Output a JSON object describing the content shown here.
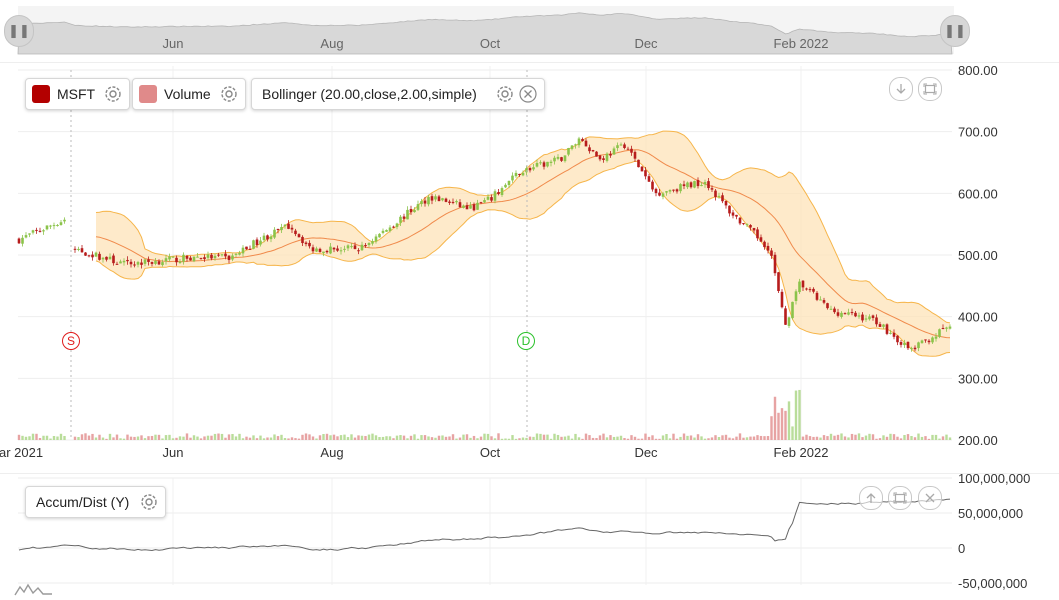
{
  "navigator": {
    "labels": [
      "Jun",
      "Aug",
      "Oct",
      "Dec",
      "Feb 2022"
    ],
    "handle_left_icon": "pause-grip-icon",
    "handle_right_icon": "pause-grip-icon"
  },
  "legend": {
    "series": [
      {
        "name": "MSFT",
        "color": "#b30000",
        "icon": "gear-icon"
      },
      {
        "name": "Volume",
        "color": "#e08a8a",
        "icon": "gear-icon"
      },
      {
        "name": "Bollinger (20.00,close,2.00,simple)",
        "icon": "gear-icon",
        "close_icon": "close-icon"
      }
    ],
    "indicator": {
      "name": "Accum/Dist (Y)",
      "icon": "gear-icon"
    }
  },
  "toolbar": {
    "main": [
      "download-icon",
      "expand-icon"
    ],
    "indicator": [
      "move-up-icon",
      "expand-icon",
      "close-icon"
    ]
  },
  "markers": [
    {
      "label": "S",
      "color": "#e01b1b",
      "date": "Mar 2021"
    },
    {
      "label": "D",
      "color": "#2bc12b",
      "date": "Oct 2021"
    }
  ],
  "colors": {
    "up": "#8bc34a",
    "down": "#b71c1c",
    "band_fill": "#fde3b8",
    "band_line": "#f6b54a",
    "middle_line": "#f08a4b",
    "ad_line": "#666666"
  },
  "chart_data": [
    {
      "type": "candlestick",
      "series": [
        {
          "name": "MSFT"
        },
        {
          "name": "Bollinger (20.00,close,2.00,simple)"
        },
        {
          "name": "Volume"
        }
      ],
      "x_tick_labels": [
        "ar 2021",
        "Jun",
        "Aug",
        "Oct",
        "Dec",
        "Feb 2022"
      ],
      "y_tick_labels": [
        "800.00",
        "700.00",
        "600.00",
        "500.00",
        "400.00",
        "300.00",
        "200.00"
      ],
      "ylim": [
        200,
        800
      ],
      "close_anchors": [
        {
          "x": "Mar 2021",
          "y": 525
        },
        {
          "x": "Mar 2021",
          "y": 558
        },
        {
          "x": "Mar 2021",
          "y": 510
        },
        {
          "x": "Apr 2021",
          "y": 485
        },
        {
          "x": "May 2021",
          "y": 497
        },
        {
          "x": "Jun 2021",
          "y": 495
        },
        {
          "x": "Jul 2021",
          "y": 525
        },
        {
          "x": "Jul 2021",
          "y": 548
        },
        {
          "x": "Jul 2021",
          "y": 510
        },
        {
          "x": "Aug 2021",
          "y": 510
        },
        {
          "x": "Sep 2021",
          "y": 540
        },
        {
          "x": "Sep 2021",
          "y": 595
        },
        {
          "x": "Sep 2021",
          "y": 575
        },
        {
          "x": "Oct 2021",
          "y": 590
        },
        {
          "x": "Oct 2021",
          "y": 635
        },
        {
          "x": "Nov 2021",
          "y": 655
        },
        {
          "x": "Nov 2021",
          "y": 690
        },
        {
          "x": "Nov 2021",
          "y": 655
        },
        {
          "x": "Dec 2021",
          "y": 680
        },
        {
          "x": "Dec 2021",
          "y": 600
        },
        {
          "x": "Jan 2022",
          "y": 620
        },
        {
          "x": "Jan 2022",
          "y": 570
        },
        {
          "x": "Jan 2022",
          "y": 510
        },
        {
          "x": "Jan 2022",
          "y": 385
        },
        {
          "x": "Feb 2022",
          "y": 455
        },
        {
          "x": "Feb 2022",
          "y": 410
        },
        {
          "x": "Feb 2022",
          "y": 395
        },
        {
          "x": "Mar 2022",
          "y": 345
        },
        {
          "x": "Mar 2022",
          "y": 385
        }
      ]
    },
    {
      "type": "line",
      "series": [
        {
          "name": "Accum/Dist (Y)"
        }
      ],
      "y_tick_labels": [
        "100,000,000",
        "50,000,000",
        "0",
        "-50,000,000"
      ],
      "ylim": [
        -50000000,
        100000000
      ]
    }
  ]
}
